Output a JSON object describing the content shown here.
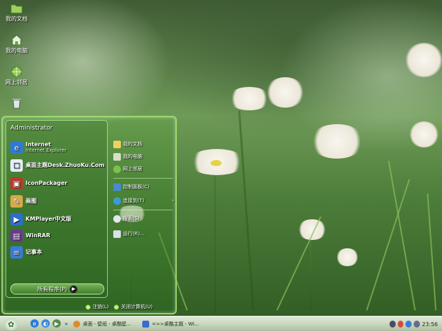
{
  "desktop": {
    "icons": [
      {
        "label": "我的文档",
        "icon": "folder-icon"
      },
      {
        "label": "我的电脑",
        "icon": "computer-icon"
      },
      {
        "label": "网上邻居",
        "icon": "network-icon"
      },
      {
        "label": "",
        "icon": "recycle-bin-icon"
      }
    ]
  },
  "start_menu": {
    "user": "Administrator",
    "programs": [
      {
        "title": "Internet",
        "subtitle": "Internet Explorer",
        "icon": "internet-explorer-icon",
        "color": "#2f7ad8"
      },
      {
        "title": "桌面主题Desk.ZhuoKu.Com",
        "subtitle": "",
        "icon": "theme-icon",
        "color": "#e5eef8"
      },
      {
        "title": "IconPackager",
        "subtitle": "",
        "icon": "iconpackager-icon",
        "color": "#b83a2a"
      },
      {
        "title": "画图",
        "subtitle": "",
        "icon": "paint-icon",
        "color": "#d8a94a"
      },
      {
        "title": "KMPlayer中文版",
        "subtitle": "",
        "icon": "kmplayer-icon",
        "color": "#2b6fd0"
      },
      {
        "title": "WinRAR",
        "subtitle": "",
        "icon": "winrar-icon",
        "color": "#6a3a8e"
      },
      {
        "title": "记事本",
        "subtitle": "",
        "icon": "notepad-icon",
        "color": "#3b7bd2"
      }
    ],
    "all_programs": "所有程序(P)",
    "right_items": [
      {
        "label": "我的文档",
        "icon": "folder-icon",
        "color": "#f0d060"
      },
      {
        "label": "我的电脑",
        "icon": "computer-icon",
        "color": "#d8e0c8"
      },
      {
        "label": "网上邻居",
        "icon": "network-icon",
        "color": "#7cc24a"
      },
      {
        "label": "控制面板(C)",
        "icon": "control-panel-icon",
        "color": "#4a8ad0"
      },
      {
        "label": "连接到(T)",
        "icon": "connect-icon",
        "color": "#3a9ad8"
      },
      {
        "label": "搜索(S)",
        "icon": "search-icon",
        "color": "#e0e8f0"
      },
      {
        "label": "运行(R)...",
        "icon": "run-icon",
        "color": "#d8e0e8"
      }
    ],
    "logoff": "注销(L)",
    "shutdown": "关闭计算机(U)"
  },
  "taskbar": {
    "tasks": [
      {
        "label": "桌面 - 壁纸 - 桌酷壁...",
        "icon": "browser-icon"
      },
      {
        "label": "=>>桌酷主题 - Wi...",
        "icon": "document-icon"
      }
    ],
    "clock": "23:56"
  },
  "colors": {
    "menu_border": "#aae678",
    "taskbar": "#c7d5bd"
  }
}
